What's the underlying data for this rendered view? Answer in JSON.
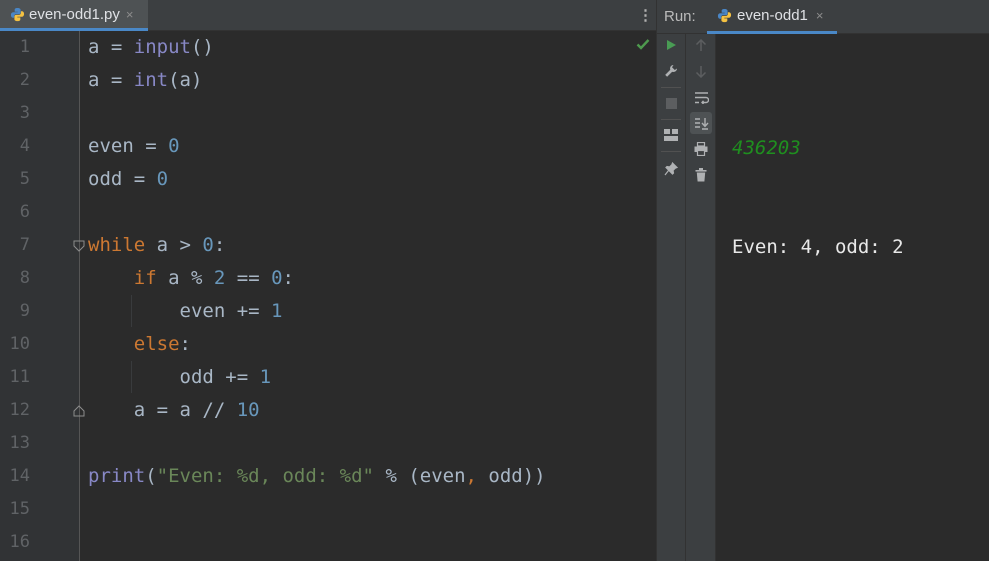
{
  "editor": {
    "tab_title": "even-odd1.py",
    "tab_close": "×",
    "menu_glyph": "⋮",
    "line_numbers": [
      "1",
      "2",
      "3",
      "4",
      "5",
      "6",
      "7",
      "8",
      "9",
      "10",
      "11",
      "12",
      "13",
      "14",
      "15",
      "16"
    ]
  },
  "code": {
    "l1": {
      "var": "a",
      "op": " = ",
      "fn": "input",
      "args": "()"
    },
    "l2": {
      "var": "a",
      "op": " = ",
      "fn": "int",
      "args": "(a)"
    },
    "l4": {
      "var": "even",
      "op": " = ",
      "num": "0"
    },
    "l5": {
      "var": "odd",
      "op": " = ",
      "num": "0"
    },
    "l7": {
      "kw": "while",
      "cond": " a > ",
      "num": "0",
      "end": ":"
    },
    "l8": {
      "indent": "    ",
      "kw": "if",
      "cond": " a % ",
      "num1": "2",
      "eq": " == ",
      "num2": "0",
      "end": ":"
    },
    "l9": {
      "indent": "        ",
      "var": "even",
      "op": " += ",
      "num": "1"
    },
    "l10": {
      "indent": "    ",
      "kw": "else",
      "end": ":"
    },
    "l11": {
      "indent": "        ",
      "var": "odd",
      "op": " += ",
      "num": "1"
    },
    "l12": {
      "indent": "    ",
      "expr": "a = a // ",
      "num": "10"
    },
    "l14": {
      "fn": "print",
      "open": "(",
      "str": "\"Even: %d, odd: %d\"",
      "mid": " % (even",
      "comma": ",",
      "rest": " odd))"
    }
  },
  "run": {
    "label": "Run:",
    "tab_title": "even-odd1",
    "tab_close": "×",
    "console_input": "436203",
    "console_output": "Even: 4, odd: 2"
  },
  "colors": {
    "keyword": "#cc7832",
    "number": "#6897bb",
    "string": "#6a8759",
    "builtin": "#8888c6",
    "input_text": "#1f8f1f",
    "accent": "#4a88c7"
  }
}
